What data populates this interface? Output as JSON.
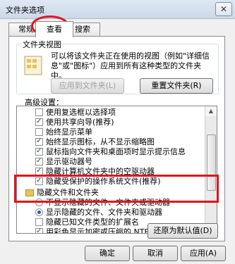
{
  "window": {
    "title": "文件夹选项",
    "close_glyph": "✕"
  },
  "tabs": [
    {
      "label": "常规"
    },
    {
      "label": "查看"
    },
    {
      "label": "搜索"
    }
  ],
  "folder_view": {
    "group_title": "文件夹视图",
    "description": "可以将该文件夹正在使用的视图（例如\"详细信\n息\"或\"图标\"）应用到所有这种类型的文件夹\n中。",
    "apply_button": "应用到文件夹(L)",
    "reset_button": "重置文件夹(R)"
  },
  "advanced": {
    "label": "高级设置：",
    "items": [
      {
        "kind": "checkbox",
        "checked": false,
        "label": "使用复选框以选择项"
      },
      {
        "kind": "checkbox",
        "checked": true,
        "label": "使用共享向导(推荐)"
      },
      {
        "kind": "checkbox",
        "checked": false,
        "label": "始终显示菜单"
      },
      {
        "kind": "checkbox",
        "checked": true,
        "label": "始终显示图标，从不显示缩略图"
      },
      {
        "kind": "checkbox",
        "checked": true,
        "label": "鼠标指向文件夹和桌面项时显示提示信息"
      },
      {
        "kind": "checkbox",
        "checked": true,
        "label": "显示驱动器号"
      },
      {
        "kind": "checkbox",
        "checked": true,
        "label": "隐藏计算机文件夹中的空驱动器"
      },
      {
        "kind": "checkbox",
        "checked": true,
        "label": "隐藏受保护的操作系统文件(推荐)"
      },
      {
        "kind": "folder",
        "label": "隐藏文件和文件夹"
      },
      {
        "kind": "radio",
        "checked": false,
        "label": "不显示隐藏的文件、文件夹或驱动器"
      },
      {
        "kind": "radio",
        "checked": true,
        "label": "显示隐藏的文件、文件夹和驱动器"
      },
      {
        "kind": "checkbox",
        "checked": false,
        "label": "隐藏已知文件类型的扩展名"
      },
      {
        "kind": "checkbox",
        "checked": true,
        "label": "用彩色显示加密或压缩的 NTFS 文件"
      }
    ],
    "restore_button": "还原为默认值(D)"
  },
  "footer": {
    "ok_button": "确定",
    "cancel_button": "取消",
    "apply_button": "应用(A)"
  },
  "annotation_color": "#e0141c"
}
